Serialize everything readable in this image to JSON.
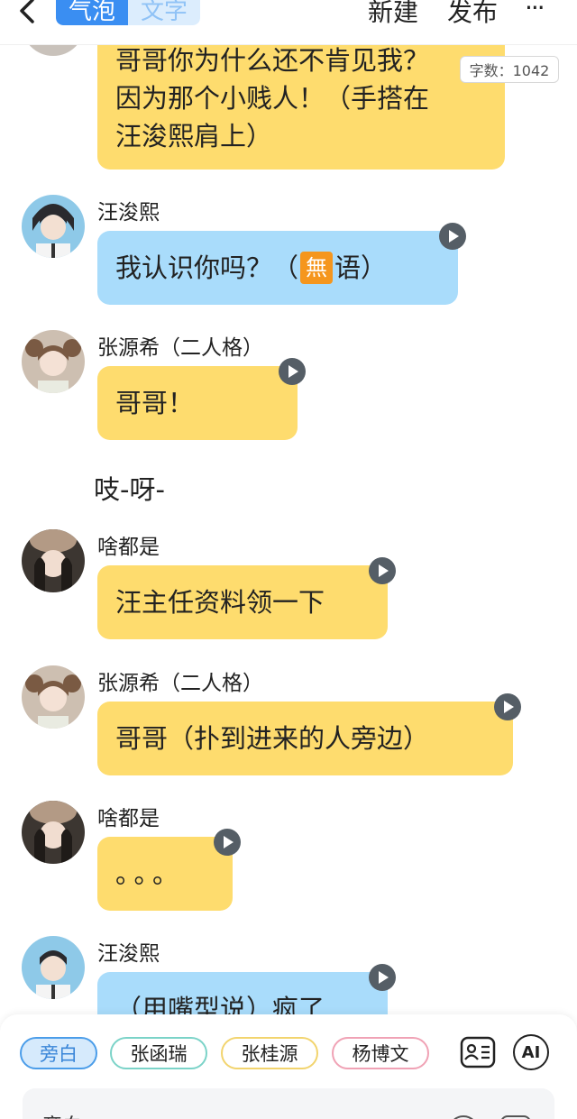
{
  "header": {
    "tab_bubble": "气泡",
    "tab_text": "文字",
    "new_label": "新建",
    "publish_label": "发布",
    "more_label": "···"
  },
  "word_count": "字数：1042",
  "messages": [
    {
      "text_lines": [
        "哥哥你为什么还不肯见我？",
        "因为那个小贱人！（手搭在",
        "汪浚熙肩上）"
      ]
    },
    {
      "name": "汪浚熙",
      "text_pre": "我认识你吗？（",
      "emoji": "無",
      "text_post": "语）"
    },
    {
      "name": "张源希（二人格）",
      "text": "哥哥！"
    },
    {
      "narration": "吱-呀-"
    },
    {
      "name": "啥都是",
      "text": "汪主任资料领一下"
    },
    {
      "name": "张源希（二人格）",
      "text": "哥哥（扑到进来的人旁边）"
    },
    {
      "name": "啥都是",
      "text": "。。。"
    },
    {
      "name": "汪浚熙",
      "text": "（用嘴型说）疯了"
    }
  ],
  "characters": {
    "narration": "旁白",
    "c1": "张函瑞",
    "c2": "张桂源",
    "c3": "杨博文"
  },
  "ai_label": "AI",
  "input": {
    "label": "旁白"
  },
  "colors": {
    "accent": "#3a8ef2",
    "bubble_yellow": "#fedc6e",
    "bubble_blue": "#a9dcfb"
  }
}
